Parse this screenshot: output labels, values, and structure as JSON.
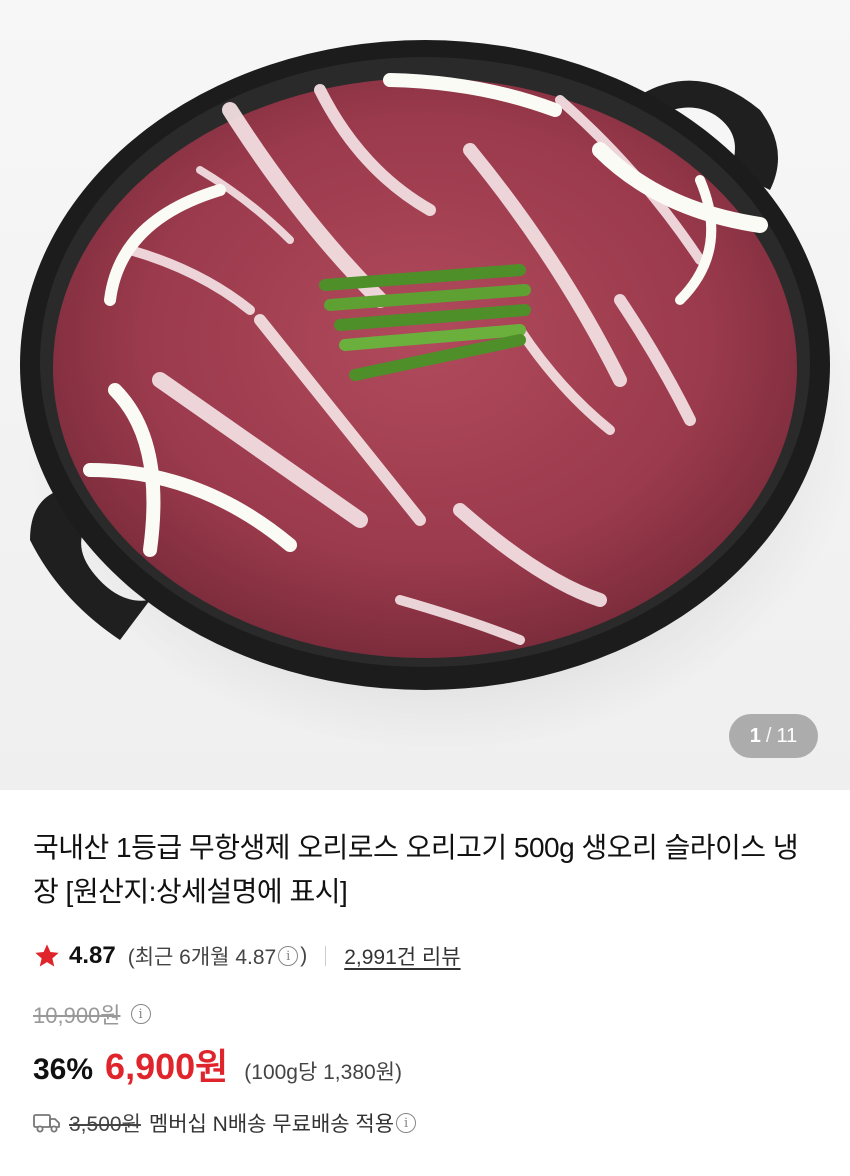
{
  "gallery": {
    "current": "1",
    "separator": "/",
    "total": "11",
    "image_description_icon": "duck-meat-in-cast-iron-pan"
  },
  "product": {
    "title": "국내산 1등급 무항생제 오리로스 오리고기 500g 생오리 슬라이스 냉장 [원산지:상세설명에 표시]"
  },
  "rating": {
    "score": "4.87",
    "recent_prefix": "(최근 6개월 4.87",
    "recent_suffix": ")",
    "info_glyph": "i",
    "reviews_link": "2,991건 리뷰"
  },
  "pricing": {
    "original_price": "10,900원",
    "discount_rate": "36%",
    "sale_price": "6,900원",
    "unit_price": "(100g당 1,380원)"
  },
  "shipping": {
    "original_fee": "3,500원",
    "text": "멤버십 N배송 무료배송 적용"
  },
  "colors": {
    "accent_red": "#e0242c",
    "star": "#e0242c"
  }
}
